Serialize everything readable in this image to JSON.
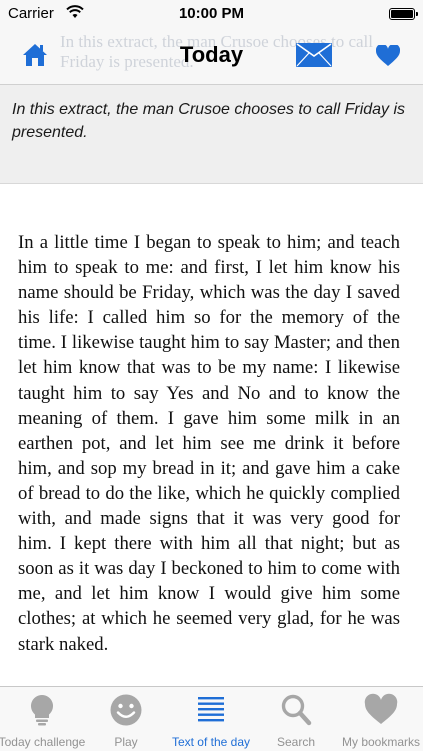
{
  "status_bar": {
    "carrier": "Carrier",
    "time": "10:00 PM"
  },
  "nav": {
    "title": "Today",
    "ghost_text": "In this extract, the man Crusoe chooses to call Friday is presented."
  },
  "intro": {
    "text": "In this extract, the man Crusoe chooses to call Friday is presented."
  },
  "passage": {
    "text": "In a little time I began to speak to him; and teach him to speak to me: and first, I let him know his name should be Friday, which was the day I saved his life: I called him so for the memory of the time. I likewise taught him to say Master; and then let him know that was to be my name: I likewise taught him to say Yes and No and to know the meaning of them. I gave him some milk in an earthen pot, and let him see me drink it before him, and sop my bread in it; and gave him a cake of bread to do the like, which he quickly complied with, and made signs that it was very good for him. I kept there with him all that night; but as soon as it was day I beckoned to him to come with me, and let him know I would give him some clothes; at which he seemed very glad, for he was stark naked."
  },
  "tabs": [
    {
      "label": "Today challenge",
      "icon": "lightbulb-icon",
      "active": false
    },
    {
      "label": "Play",
      "icon": "smiley-icon",
      "active": false
    },
    {
      "label": "Text of the day",
      "icon": "text-lines-icon",
      "active": true
    },
    {
      "label": "Search",
      "icon": "magnifier-icon",
      "active": false
    },
    {
      "label": "My bookmarks",
      "icon": "heart-icon",
      "active": false
    }
  ],
  "colors": {
    "accent": "#1f6ed6",
    "tab_inactive": "#929292",
    "bar_background": "#f7f7f7",
    "intro_background": "#efefef"
  }
}
